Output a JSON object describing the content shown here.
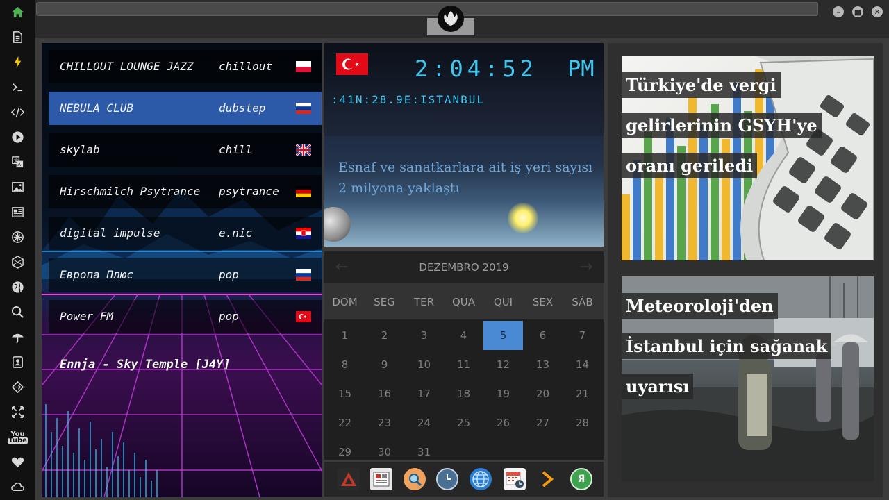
{
  "sidebar": {
    "icons": [
      "home-icon",
      "document-icon",
      "lightning-icon",
      "terminal-icon",
      "code-icon",
      "play-icon",
      "translate-icon",
      "image-icon",
      "news-icon",
      "gear-icon",
      "hexagon-icon",
      "globe-icon",
      "search-icon",
      "umbrella-icon",
      "contact-icon",
      "share-icon",
      "expand-icon",
      "youtube-icon",
      "heart-icon",
      "cloud-icon"
    ],
    "youtube_label": "You"
  },
  "window": {
    "controls": [
      "minimize-icon",
      "maximize-icon",
      "close-icon"
    ]
  },
  "radio": {
    "stations": [
      {
        "name": "CHILLOUT LOUNGE JAZZ",
        "genre": "chillout",
        "flag": "poland"
      },
      {
        "name": "NEBULA CLUB",
        "genre": "dubstep",
        "flag": "russia"
      },
      {
        "name": "skylab",
        "genre": "chill",
        "flag": "uk"
      },
      {
        "name": "Hirschmilch Psytrance",
        "genre": "psytrance",
        "flag": "germany"
      },
      {
        "name": "digital impulse",
        "genre": "e.nic",
        "flag": "croatia"
      },
      {
        "name": "Европа Плюс",
        "genre": "pop",
        "flag": "russia"
      },
      {
        "name": "Power FM",
        "genre": "pop",
        "flag": "turkey"
      }
    ],
    "now_playing": "Ennja - Sky Temple [J4Y]"
  },
  "clock": {
    "time": "2:04:52",
    "ampm": "PM",
    "location": ":41N:28.9E:ISTANBUL",
    "headline": "Esnaf ve sanatkarlara ait iş yeri sayısı 2 milyona yaklaştı"
  },
  "calendar": {
    "title": "DEZEMBRO 2019",
    "prev": "←",
    "next": "→",
    "weekdays": [
      "DOM",
      "SEG",
      "TER",
      "QUA",
      "QUI",
      "SEX",
      "SÁB"
    ],
    "days": [
      "1",
      "2",
      "3",
      "4",
      "5",
      "6",
      "7",
      "8",
      "9",
      "10",
      "11",
      "12",
      "13",
      "14",
      "15",
      "16",
      "17",
      "18",
      "19",
      "20",
      "21",
      "22",
      "23",
      "24",
      "25",
      "26",
      "27",
      "28",
      "29",
      "30",
      "31"
    ],
    "today": "5"
  },
  "dock": {
    "icons": [
      {
        "name": "app-launcher-icon",
        "color": "#c0392b"
      },
      {
        "name": "newspaper-icon",
        "color": "#d8d8d8"
      },
      {
        "name": "search-icon",
        "color": "#f0a35e"
      },
      {
        "name": "clock-icon",
        "color": "#4a6f95"
      },
      {
        "name": "globe-icon",
        "color": "#2a7fd4"
      },
      {
        "name": "calendar-icon",
        "color": "#e74c3c"
      },
      {
        "name": "forward-icon",
        "color": "#f39c12"
      },
      {
        "name": "yandex-icon",
        "color": "#3fa34d"
      }
    ],
    "yandex_label": "Я"
  },
  "news": [
    {
      "title": "Türkiye'de vergi gelirlerinin GSYH'ye oranı geriledi"
    },
    {
      "title": "Meteoroloji'den İstanbul için sağanak uyarısı"
    }
  ]
}
